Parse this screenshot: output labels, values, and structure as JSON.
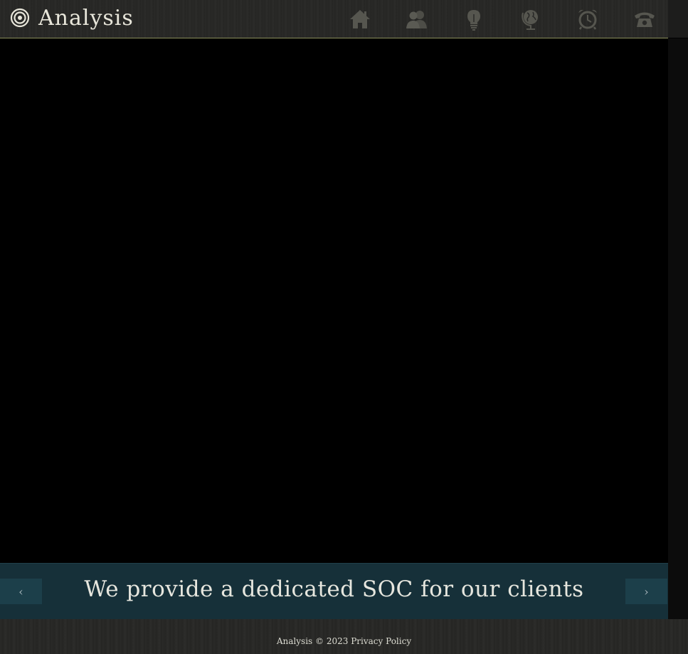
{
  "brand": {
    "name": "Analysis",
    "logo_icon": "target-icon"
  },
  "nav": {
    "items": [
      {
        "icon": "home-icon"
      },
      {
        "icon": "users-icon"
      },
      {
        "icon": "lightbulb-icon"
      },
      {
        "icon": "globe-icon"
      },
      {
        "icon": "alarm-clock-icon"
      },
      {
        "icon": "phone-icon"
      }
    ]
  },
  "slider": {
    "caption": "We provide a dedicated SOC for our clients",
    "prev_label": "‹",
    "next_label": "›"
  },
  "footer": {
    "site": "Analysis",
    "copyright": "© 2023",
    "privacy_label": "Privacy Policy"
  },
  "colors": {
    "header_bg": "#2a2a28",
    "accent_line": "#8a8d5a",
    "caption_bg": "#163039",
    "arrow_bg": "#1c3f4a",
    "icon": "#555550"
  }
}
